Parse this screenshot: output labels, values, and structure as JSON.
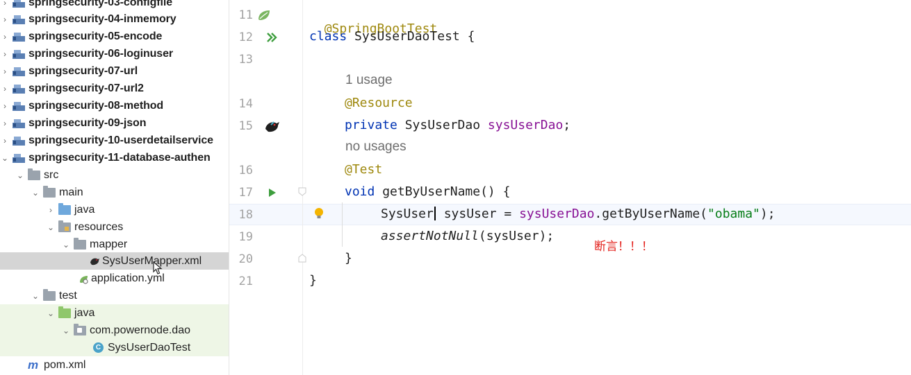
{
  "project_tree": {
    "modules": [
      {
        "label": "springsecurity-03-configfile"
      },
      {
        "label": "springsecurity-04-inmemory"
      },
      {
        "label": "springsecurity-05-encode"
      },
      {
        "label": "springsecurity-06-loginuser"
      },
      {
        "label": "springsecurity-07-url"
      },
      {
        "label": "springsecurity-07-url2"
      },
      {
        "label": "springsecurity-08-method"
      },
      {
        "label": "springsecurity-09-json"
      },
      {
        "label": "springsecurity-10-userdetailservice"
      },
      {
        "label": "springsecurity-11-database-authen"
      }
    ],
    "src": "src",
    "main": "main",
    "java": "java",
    "resources": "resources",
    "mapper": "mapper",
    "mapper_xml": "SysUserMapper.xml",
    "application_yml": "application.yml",
    "test": "test",
    "test_java": "java",
    "package": "com.powernode.dao",
    "test_class": "SysUserDaoTest",
    "pom": "pom.xml"
  },
  "gutter": {
    "lines": [
      "11",
      "12",
      "13",
      "14",
      "15",
      "16",
      "17",
      "18",
      "19",
      "20",
      "21"
    ]
  },
  "code": {
    "l11_annotation": "@SpringBootTest",
    "l12_kw": "class",
    "l12_rest": " SysUserDaoTest {",
    "hint_usage": "1 usage",
    "l14_annotation": "@Resource",
    "l15_kw": "private",
    "l15_type": " SysUserDao ",
    "l15_field": "sysUserDao",
    "l15_end": ";",
    "hint_no_usages": "no usages",
    "l16_annotation": "@Test",
    "l17_kw": "void",
    "l17_rest": " getByUserName() {",
    "l18_type": "SysUser",
    "l18_mid": " sysUser = ",
    "l18_field": "sysUserDao",
    "l18_call": ".getByUserName(",
    "l18_str": "\"obama\"",
    "l18_end": ");",
    "l19_method": "assertNotNull",
    "l19_rest": "(sysUser);",
    "l20": "}",
    "l21": "}"
  },
  "annotation_note": "断言！！！"
}
